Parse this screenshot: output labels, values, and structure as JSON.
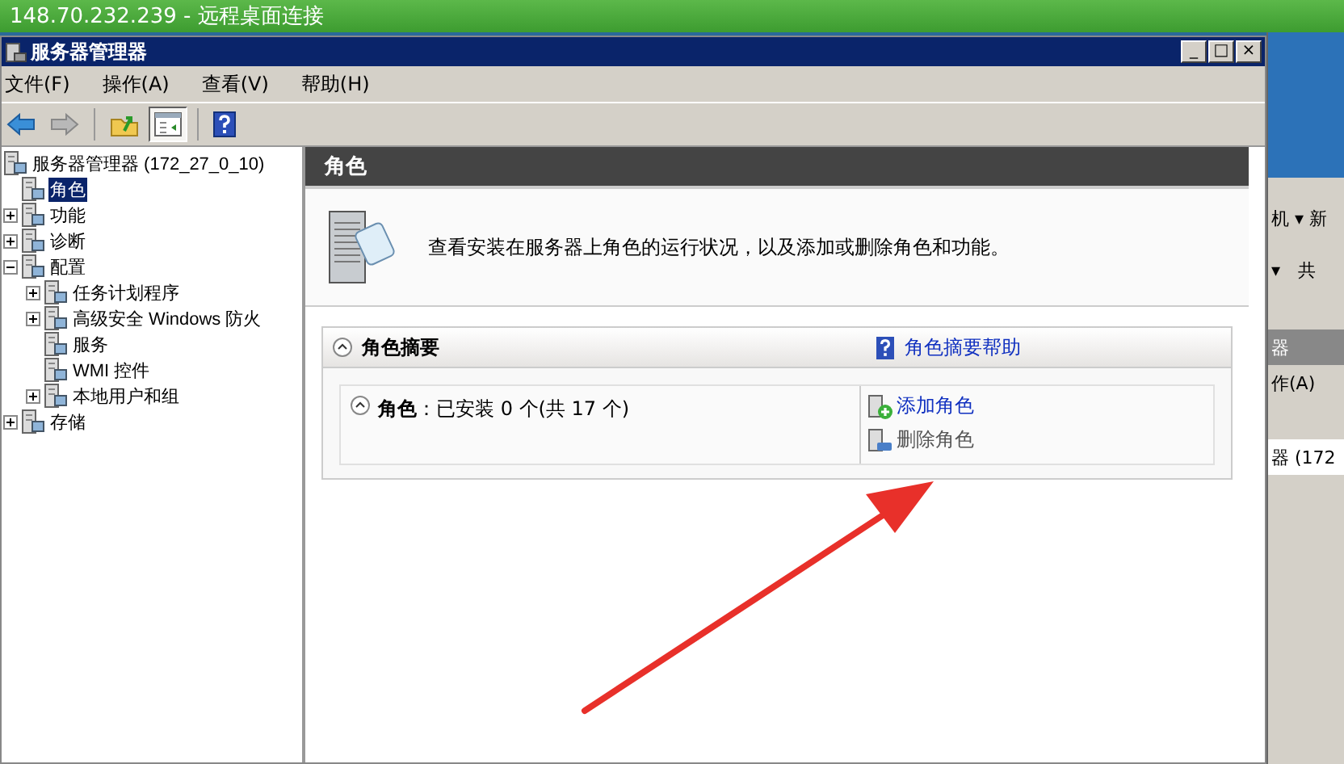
{
  "rdp_bar": {
    "title": "148.70.232.239 - 远程桌面连接"
  },
  "window": {
    "title": "服务器管理器",
    "buttons": [
      "_",
      "□",
      "×"
    ]
  },
  "menu": [
    "文件(F)",
    "操作(A)",
    "查看(V)",
    "帮助(H)"
  ],
  "toolbar": [
    {
      "kind": "back",
      "pressed": false
    },
    {
      "kind": "forward",
      "pressed": false
    },
    {
      "kind": "sep"
    },
    {
      "kind": "up",
      "pressed": false
    },
    {
      "kind": "tree",
      "pressed": true
    },
    {
      "kind": "sep"
    },
    {
      "kind": "help",
      "pressed": false
    }
  ],
  "tree": [
    {
      "label": "服务器管理器 (172_27_0_10)",
      "kind": "root",
      "selected": false,
      "children": [
        {
          "label": "角色",
          "kind": "leaf",
          "selected": true
        },
        {
          "label": "功能",
          "kind": "collapsed",
          "selected": false
        },
        {
          "label": "诊断",
          "kind": "collapsed",
          "selected": false
        },
        {
          "label": "配置",
          "kind": "expanded",
          "selected": false,
          "children": [
            {
              "label": "任务计划程序",
              "kind": "collapsed",
              "selected": false
            },
            {
              "label": "高级安全 Windows 防火",
              "kind": "collapsed",
              "selected": false
            },
            {
              "label": "服务",
              "kind": "leaf",
              "selected": false
            },
            {
              "label": "WMI 控件",
              "kind": "leaf",
              "selected": false
            },
            {
              "label": "本地用户和组",
              "kind": "collapsed",
              "selected": false
            }
          ]
        },
        {
          "label": "存储",
          "kind": "collapsed",
          "selected": false
        }
      ]
    }
  ],
  "pane": {
    "title": "角色",
    "description": "查看安装在服务器上角色的运行状况，以及添加或删除角色和功能。",
    "section": {
      "title": "角色摘要",
      "help_link": "角色摘要帮助",
      "expanded": true,
      "summary": {
        "label": "角色",
        "text": "：已安装 0 个(共 17 个)",
        "expanded": true
      },
      "actions": [
        {
          "kind": "add",
          "label": "添加角色",
          "enabled": true
        },
        {
          "kind": "remove",
          "label": "删除角色",
          "enabled": false
        }
      ]
    }
  },
  "background_window": {
    "lines": [
      "机 ▾ 新",
      "▾　共",
      "器",
      "作(A)",
      "器 (172"
    ]
  }
}
